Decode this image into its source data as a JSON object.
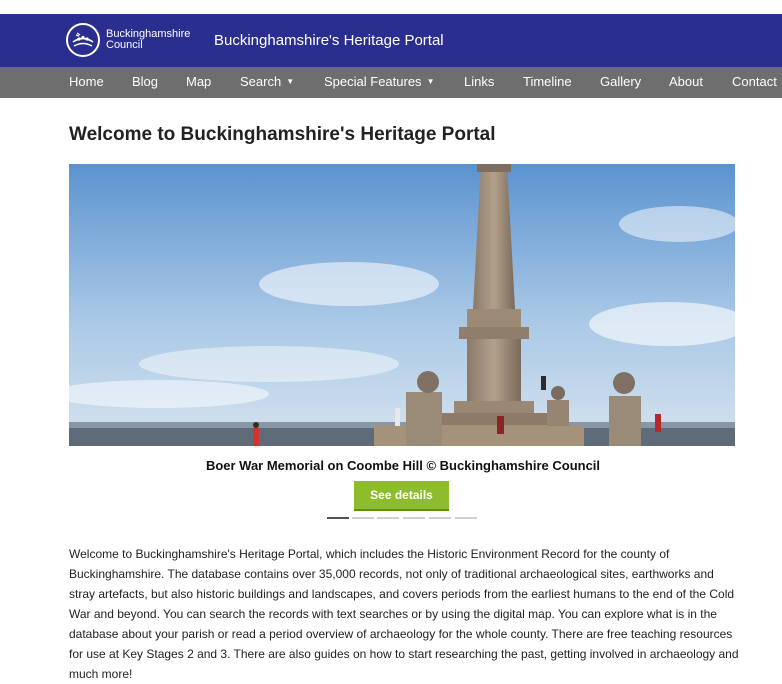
{
  "header": {
    "logo_line1": "Buckinghamshire",
    "logo_line2": "Council",
    "portal_title": "Buckinghamshire's Heritage Portal",
    "brand_color": "#2a2f8f"
  },
  "nav": {
    "items": [
      {
        "label": "Home"
      },
      {
        "label": "Blog"
      },
      {
        "label": "Map"
      },
      {
        "label": "Search"
      },
      {
        "label": "Special Features"
      },
      {
        "label": "Links"
      },
      {
        "label": "Timeline"
      },
      {
        "label": "Gallery"
      },
      {
        "label": "About"
      },
      {
        "label": "Contact"
      }
    ],
    "caret": "▼"
  },
  "main": {
    "title": "Welcome to Buckinghamshire's Heritage Portal",
    "carousel": {
      "caption": "Boer War Memorial on Coombe Hill © Buckinghamshire Council",
      "button_label": "See details",
      "button_color": "#8dbd2c",
      "slide_count": 6,
      "active_slide": 1
    },
    "intro": "Welcome to Buckinghamshire's Heritage Portal, which includes the Historic Environment Record for the county of Buckinghamshire. The database contains over 35,000 records, not only of traditional archaeological sites, earthworks and stray artefacts, but also historic buildings and landscapes, and covers periods from the earliest humans to the end of the Cold War and beyond. You can search the records with text searches or by using the digital map. You can explore what is in the database about your parish or read a period overview of archaeology for the whole county. There are free teaching resources for use at Key Stages 2 and 3. There are also guides on how to start researching the past, getting involved in archaeology and much more!"
  }
}
